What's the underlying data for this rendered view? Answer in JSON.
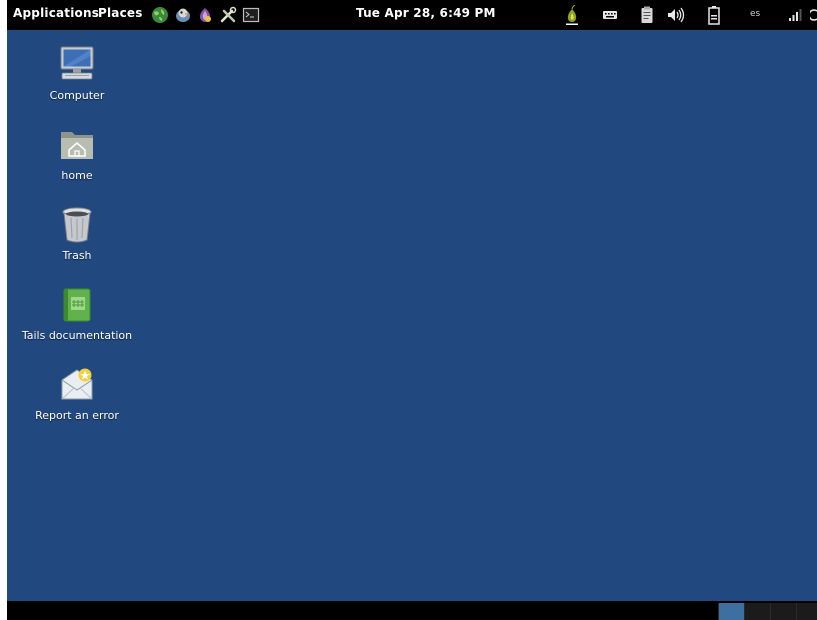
{
  "top_panel": {
    "applications_label": "Applications",
    "places_label": "Places",
    "clock_text": "Tue Apr 28,  6:49 PM",
    "keyboard_layout": "es",
    "launchers": [
      "tor-globe-icon",
      "pidgin-icon",
      "onionshare-icon",
      "tools-icon",
      "terminal-icon"
    ],
    "tray": [
      "vidalia-onion-icon",
      "onscreen-keyboard-icon",
      "clipboard-icon",
      "volume-icon",
      "battery-icon",
      "keyboard-layout-indicator",
      "network-signal-icon",
      "power-icon"
    ]
  },
  "desktop": {
    "background_color": "#21487f",
    "icons": [
      {
        "name": "computer",
        "label": "Computer"
      },
      {
        "name": "home",
        "label": "home"
      },
      {
        "name": "trash",
        "label": "Trash"
      },
      {
        "name": "tails-documentation",
        "label": "Tails documentation"
      },
      {
        "name": "report-an-error",
        "label": "Report an error"
      }
    ]
  },
  "bottom_panel": {
    "workspaces": [
      {
        "name": "workspace-1",
        "active": true
      },
      {
        "name": "workspace-2",
        "active": false
      },
      {
        "name": "workspace-3",
        "active": false
      },
      {
        "name": "workspace-4",
        "active": false
      }
    ]
  }
}
